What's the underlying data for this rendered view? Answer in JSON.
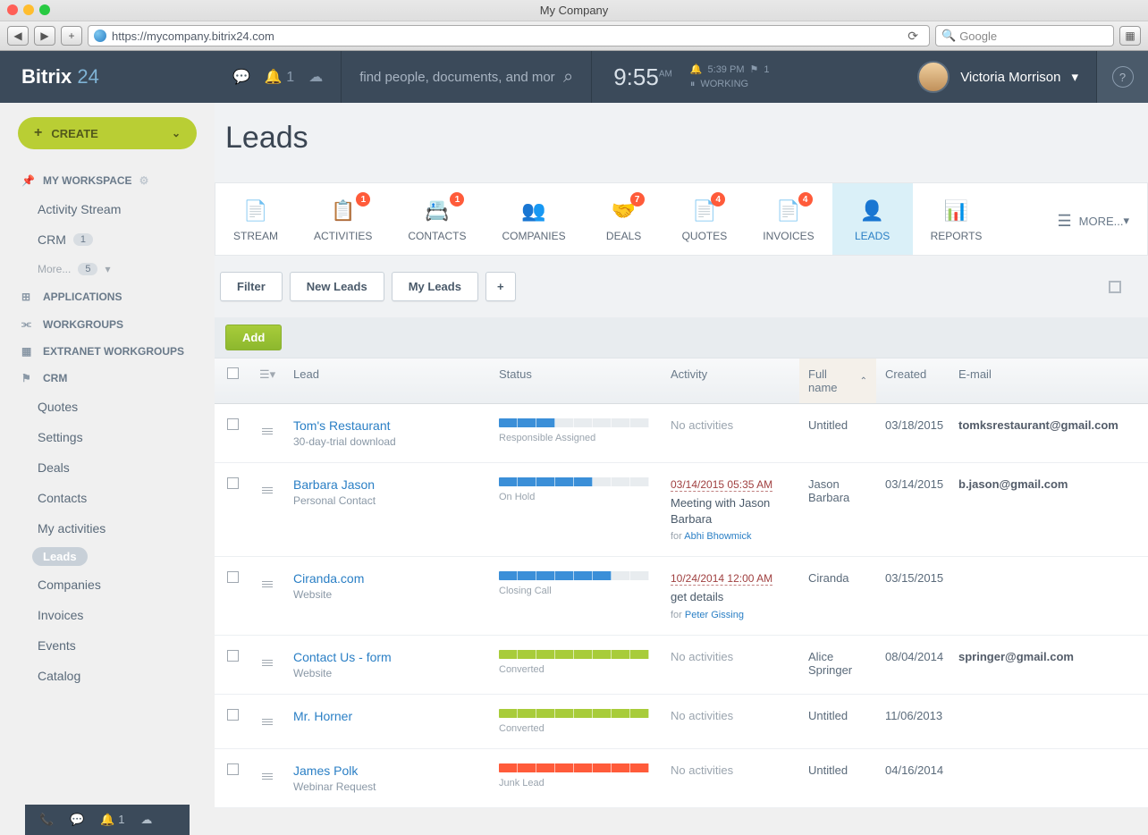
{
  "browser": {
    "title": "My Company",
    "url": "https://mycompany.bitrix24.com",
    "search_placeholder": "Google"
  },
  "header": {
    "logo_text": "Bitrix",
    "logo_num": "24",
    "notification_count": "1",
    "search_placeholder": "find people, documents, and mor",
    "clock": "9:55",
    "clock_suffix": "AM",
    "clock_time2": "5:39 PM",
    "clock_flag": "1",
    "clock_status": "WORKING",
    "user_name": "Victoria Morrison"
  },
  "sidebar": {
    "create_label": "CREATE",
    "sections": {
      "workspace": "MY WORKSPACE",
      "applications": "APPLICATIONS",
      "workgroups": "WORKGROUPS",
      "extranet": "EXTRANET WORKGROUPS",
      "crm": "CRM"
    },
    "workspace_items": [
      {
        "label": "Activity Stream"
      },
      {
        "label": "CRM",
        "badge": "1"
      },
      {
        "label": "More...",
        "badge": "5",
        "more": true
      }
    ],
    "crm_items": [
      {
        "label": "Quotes"
      },
      {
        "label": "Settings"
      },
      {
        "label": "Deals"
      },
      {
        "label": "Contacts"
      },
      {
        "label": "My activities"
      },
      {
        "label": "Leads",
        "active": true
      },
      {
        "label": "Companies"
      },
      {
        "label": "Invoices"
      },
      {
        "label": "Events"
      },
      {
        "label": "Catalog"
      }
    ],
    "bottom_notif": "1"
  },
  "page": {
    "title": "Leads",
    "nav": [
      {
        "label": "STREAM",
        "badge": null
      },
      {
        "label": "ACTIVITIES",
        "badge": "1"
      },
      {
        "label": "CONTACTS",
        "badge": "1"
      },
      {
        "label": "COMPANIES",
        "badge": null
      },
      {
        "label": "DEALS",
        "badge": "7"
      },
      {
        "label": "QUOTES",
        "badge": "4"
      },
      {
        "label": "INVOICES",
        "badge": "4"
      },
      {
        "label": "LEADS",
        "badge": null,
        "active": true
      },
      {
        "label": "REPORTS",
        "badge": null
      }
    ],
    "nav_more": "MORE...",
    "filters": [
      "Filter",
      "New Leads",
      "My Leads"
    ],
    "add_label": "Add",
    "columns": {
      "lead": "Lead",
      "status": "Status",
      "activity": "Activity",
      "full_name": "Full name",
      "created": "Created",
      "email": "E-mail"
    }
  },
  "rows": [
    {
      "lead": "Tom's Restaurant",
      "sub": "30-day-trial download",
      "status_label": "Responsible Assigned",
      "status_color": "#3b8fd8",
      "status_pct": 33,
      "activity": {
        "none": "No activities"
      },
      "name": "Untitled",
      "created": "03/18/2015",
      "email": "tomksrestaurant@gmail.com"
    },
    {
      "lead": "Barbara Jason",
      "sub": "Personal Contact",
      "status_label": "On Hold",
      "status_color": "#3b8fd8",
      "status_pct": 60,
      "activity": {
        "date": "03/14/2015 05:35 AM",
        "text": "Meeting with Jason Barbara",
        "for": "Abhi Bhowmick"
      },
      "name": "Jason Barbara",
      "created": "03/14/2015",
      "email": "b.jason@gmail.com"
    },
    {
      "lead": "Ciranda.com",
      "sub": "Website",
      "status_label": "Closing Call",
      "status_color": "#3b8fd8",
      "status_pct": 70,
      "activity": {
        "date": "10/24/2014 12:00 AM",
        "text": "get details",
        "for": "Peter Gissing"
      },
      "name": "Ciranda",
      "created": "03/15/2015",
      "email": ""
    },
    {
      "lead": "Contact Us - form",
      "sub": "Website",
      "status_label": "Converted",
      "status_color": "#a8cc3a",
      "status_pct": 100,
      "activity": {
        "none": "No activities"
      },
      "name": "Alice Springer",
      "created": "08/04/2014",
      "email": "springer@gmail.com"
    },
    {
      "lead": "Mr. Horner",
      "sub": "",
      "status_label": "Converted",
      "status_color": "#a8cc3a",
      "status_pct": 100,
      "activity": {
        "none": "No activities"
      },
      "name": "Untitled",
      "created": "11/06/2013",
      "email": ""
    },
    {
      "lead": "James Polk",
      "sub": "Webinar Request",
      "status_label": "Junk Lead",
      "status_color": "#ff5b3a",
      "status_pct": 100,
      "activity": {
        "none": "No activities"
      },
      "name": "Untitled",
      "created": "04/16/2014",
      "email": ""
    }
  ]
}
